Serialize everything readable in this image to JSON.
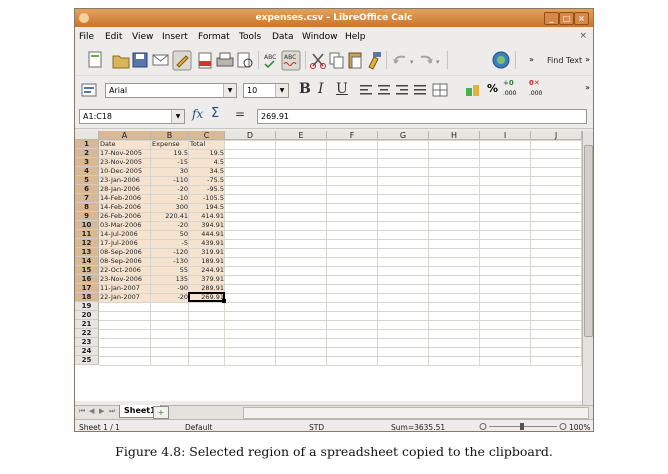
{
  "window": {
    "title": "expenses.csv - LibreOffice Calc",
    "controls": [
      "_",
      "□",
      "×"
    ]
  },
  "menu": {
    "items": [
      "File",
      "Edit",
      "View",
      "Insert",
      "Format",
      "Tools",
      "Data",
      "Window",
      "Help"
    ],
    "close": "×"
  },
  "toolbar": {
    "find_text": "Find Text",
    "overflow": "»",
    "icons": [
      "new-document-icon",
      "open-icon",
      "save-icon",
      "email-icon",
      "edit-file-icon",
      "export-pdf-icon",
      "print-icon",
      "print-preview-icon",
      "spellcheck-icon",
      "autospellcheck-icon",
      "cut-icon",
      "copy-icon",
      "paste-icon",
      "clone-format-icon",
      "undo-icon",
      "redo-icon",
      "navigator-icon"
    ]
  },
  "format": {
    "styles_icon": "styles-icon",
    "font_name": "Arial",
    "font_size": "10",
    "bold": "B",
    "italic": "I",
    "underline": "U",
    "currency": "$",
    "percent": "%",
    "add_decimal": ".000",
    "del_decimal": ".000",
    "add_decimal_mark": "+0",
    "del_decimal_mark": "0✕"
  },
  "formula": {
    "cell_ref": "A1:C18",
    "function_wizard": "fx",
    "sum_symbol": "Σ",
    "equals": "=",
    "value": "269.91"
  },
  "sheet": {
    "columns": [
      "A",
      "B",
      "C",
      "D",
      "E",
      "F",
      "G",
      "H",
      "I",
      "J"
    ],
    "selected_columns": [
      "A",
      "B",
      "C"
    ],
    "row_numbers": [
      "1",
      "2",
      "3",
      "4",
      "5",
      "6",
      "7",
      "8",
      "9",
      "10",
      "11",
      "12",
      "13",
      "14",
      "15",
      "16",
      "17",
      "18",
      "19",
      "20",
      "21",
      "22",
      "23",
      "24",
      "25"
    ],
    "header_row": [
      "Date",
      "Expense",
      "Total"
    ],
    "rows": [
      [
        "17-Nov-2005",
        "19.5",
        "19.5"
      ],
      [
        "23-Nov-2005",
        "-15",
        "4.5"
      ],
      [
        "10-Dec-2005",
        "30",
        "34.5"
      ],
      [
        "23-Jan-2006",
        "-110",
        "-75.5"
      ],
      [
        "28-Jan-2006",
        "-20",
        "-95.5"
      ],
      [
        "14-Feb-2006",
        "-10",
        "-105.5"
      ],
      [
        "14-Feb-2006",
        "300",
        "194.5"
      ],
      [
        "26-Feb-2006",
        "220.41",
        "414.91"
      ],
      [
        "03-Mar-2006",
        "-20",
        "394.91"
      ],
      [
        "14-Jul-2006",
        "50",
        "444.91"
      ],
      [
        "17-Jul-2006",
        "-5",
        "439.91"
      ],
      [
        "08-Sep-2006",
        "-120",
        "319.91"
      ],
      [
        "08-Sep-2006",
        "-130",
        "189.91"
      ],
      [
        "22-Oct-2006",
        "55",
        "244.91"
      ],
      [
        "23-Nov-2006",
        "135",
        "379.91"
      ],
      [
        "11-Jan-2007",
        "-90",
        "289.91"
      ],
      [
        "22-Jan-2007",
        "-20",
        "269.91"
      ]
    ]
  },
  "tabs": {
    "active": "Sheet1"
  },
  "status": {
    "sheet": "Sheet 1 / 1",
    "style": "Default",
    "mode": "STD",
    "sum": "Sum=3635.51",
    "zoom": "100%"
  },
  "caption": "Figure 4.8: Selected region of a spreadsheet copied to the clipboard."
}
